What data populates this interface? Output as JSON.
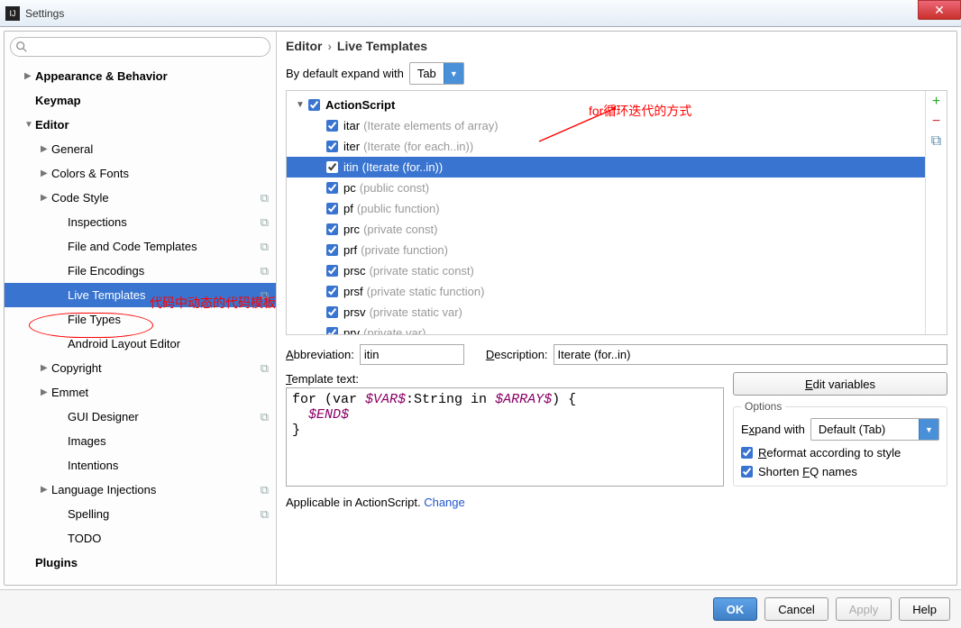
{
  "window": {
    "title": "Settings"
  },
  "sidebar": {
    "items": [
      {
        "label": "Appearance & Behavior",
        "bold": true,
        "arrow": "▶",
        "indent": 0
      },
      {
        "label": "Keymap",
        "bold": true,
        "indent": 0
      },
      {
        "label": "Editor",
        "bold": true,
        "arrow": "▼",
        "indent": 0
      },
      {
        "label": "General",
        "arrow": "▶",
        "indent": 1
      },
      {
        "label": "Colors & Fonts",
        "arrow": "▶",
        "indent": 1
      },
      {
        "label": "Code Style",
        "arrow": "▶",
        "indent": 1,
        "copy": true
      },
      {
        "label": "Inspections",
        "indent": 2,
        "copy": true
      },
      {
        "label": "File and Code Templates",
        "indent": 2,
        "copy": true
      },
      {
        "label": "File Encodings",
        "indent": 2,
        "copy": true
      },
      {
        "label": "Live Templates",
        "indent": 2,
        "copy": true,
        "selected": true
      },
      {
        "label": "File Types",
        "indent": 2
      },
      {
        "label": "Android Layout Editor",
        "indent": 2
      },
      {
        "label": "Copyright",
        "arrow": "▶",
        "indent": 1,
        "copy": true
      },
      {
        "label": "Emmet",
        "arrow": "▶",
        "indent": 1
      },
      {
        "label": "GUI Designer",
        "indent": 2,
        "copy": true
      },
      {
        "label": "Images",
        "indent": 2
      },
      {
        "label": "Intentions",
        "indent": 2
      },
      {
        "label": "Language Injections",
        "arrow": "▶",
        "indent": 1,
        "copy": true
      },
      {
        "label": "Spelling",
        "indent": 2,
        "copy": true
      },
      {
        "label": "TODO",
        "indent": 2
      },
      {
        "label": "Plugins",
        "bold": true,
        "indent": 0
      }
    ]
  },
  "breadcrumb": {
    "a": "Editor",
    "b": "Live Templates"
  },
  "expand": {
    "label": "By default expand with",
    "value": "Tab"
  },
  "group": {
    "name": "ActionScript"
  },
  "templates": [
    {
      "abbr": "itar",
      "desc": "(Iterate elements of array)"
    },
    {
      "abbr": "iter",
      "desc": "(Iterate (for each..in))"
    },
    {
      "abbr": "itin",
      "desc": "(Iterate (for..in))",
      "selected": true
    },
    {
      "abbr": "pc",
      "desc": "(public const)"
    },
    {
      "abbr": "pf",
      "desc": "(public function)"
    },
    {
      "abbr": "prc",
      "desc": "(private const)"
    },
    {
      "abbr": "prf",
      "desc": "(private function)"
    },
    {
      "abbr": "prsc",
      "desc": "(private static const)"
    },
    {
      "abbr": "prsf",
      "desc": "(private static function)"
    },
    {
      "abbr": "prsv",
      "desc": "(private static var)"
    },
    {
      "abbr": "prv",
      "desc": "(private var)"
    }
  ],
  "fields": {
    "abbr_label": "Abbreviation:",
    "abbr_value": "itin",
    "desc_label": "Description:",
    "desc_value": "Iterate (for..in)",
    "tpl_label": "Template text:",
    "editvars": "Edit variables"
  },
  "code": {
    "p1": "for (var ",
    "v1": "$VAR$",
    "p2": ":String in ",
    "v2": "$ARRAY$",
    "p3": ") {",
    "l2": "  ",
    "v3": "$END$",
    "l3": "}"
  },
  "options": {
    "legend": "Options",
    "expand_label": "Expand with",
    "expand_value": "Default (Tab)",
    "reformat": "Reformat according to style",
    "shorten": "Shorten FQ names"
  },
  "applicable": {
    "text": "Applicable in ActionScript. ",
    "link": "Change"
  },
  "buttons": {
    "ok": "OK",
    "cancel": "Cancel",
    "apply": "Apply",
    "help": "Help"
  },
  "annotations": {
    "a1": "for循环迭代的方式",
    "a2": "代码中动态的代码模板"
  }
}
